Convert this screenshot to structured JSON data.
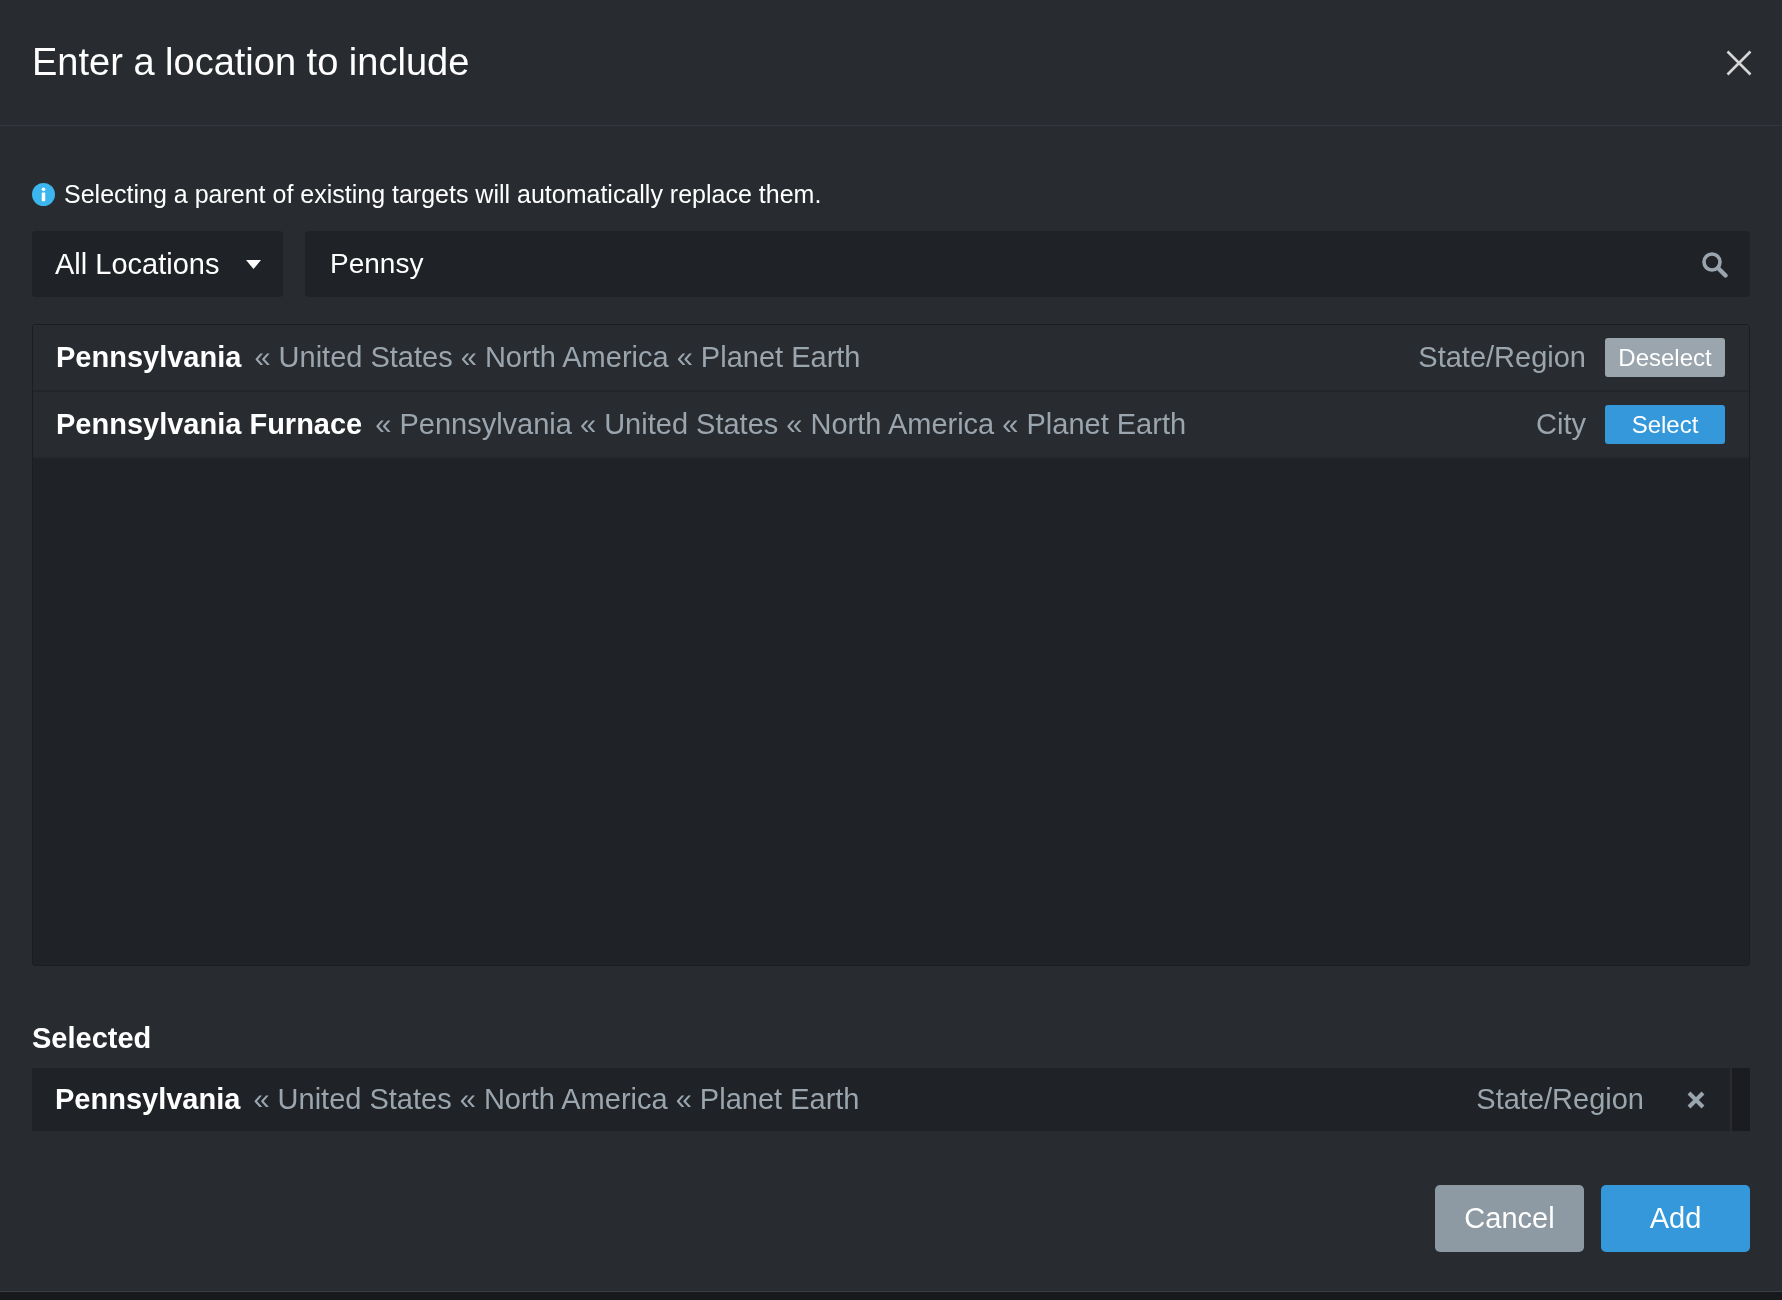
{
  "dialog": {
    "title": "Enter a location to include"
  },
  "notice": {
    "text": "Selecting a parent of existing targets will automatically replace them."
  },
  "filters": {
    "dropdown": {
      "label": "All Locations"
    },
    "search": {
      "value": "Pennsy"
    }
  },
  "results": [
    {
      "name": "Pennsylvania",
      "path": "« United States « North America « Planet Earth",
      "type": "State/Region",
      "selected": true,
      "action": "Deselect"
    },
    {
      "name": "Pennsylvania Furnace",
      "path": "« Pennsylvania « United States « North America « Planet Earth",
      "type": "City",
      "selected": false,
      "action": "Select"
    }
  ],
  "selected_section": {
    "heading": "Selected",
    "items": [
      {
        "name": "Pennsylvania",
        "path": "« United States « North America « Planet Earth",
        "type": "State/Region"
      }
    ]
  },
  "buttons": [
    {
      "label": "Cancel",
      "kind": "secondary"
    },
    {
      "label": "Add",
      "kind": "primary"
    }
  ]
}
